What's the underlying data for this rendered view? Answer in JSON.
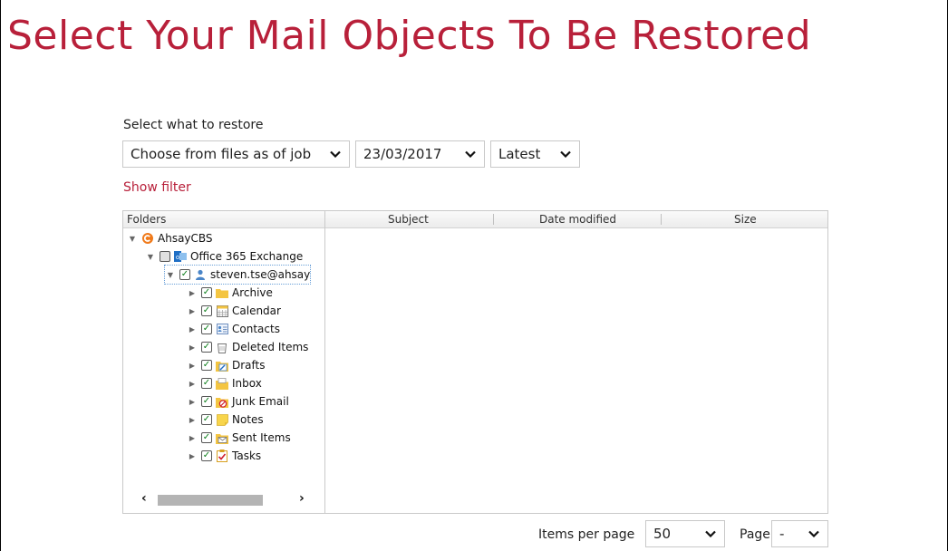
{
  "title": "Select Your Mail Objects To Be Restored",
  "restore": {
    "label": "Select what to restore",
    "mode_value": "Choose from files as of job",
    "date_value": "23/03/2017",
    "time_value": "Latest",
    "show_filter": "Show filter"
  },
  "columns": {
    "folders": "Folders",
    "subject": "Subject",
    "date_modified": "Date modified",
    "size": "Size"
  },
  "tree": {
    "root": "AhsayCBS",
    "exchange": "Office 365 Exchange",
    "user": "steven.tse@ahsay",
    "folders": [
      "Archive",
      "Calendar",
      "Contacts",
      "Deleted Items",
      "Drafts",
      "Inbox",
      "Junk Email",
      "Notes",
      "Sent Items",
      "Tasks"
    ]
  },
  "footer": {
    "items_per_page_label": "Items per page",
    "items_per_page_value": "50",
    "page_label": "Page",
    "page_value": "-"
  },
  "colors": {
    "accent": "#b8203a",
    "check": "#0a7d18",
    "folder": "#f4c542",
    "outlook_blue": "#1f6fc5",
    "ahsay_orange": "#f07a1a"
  }
}
